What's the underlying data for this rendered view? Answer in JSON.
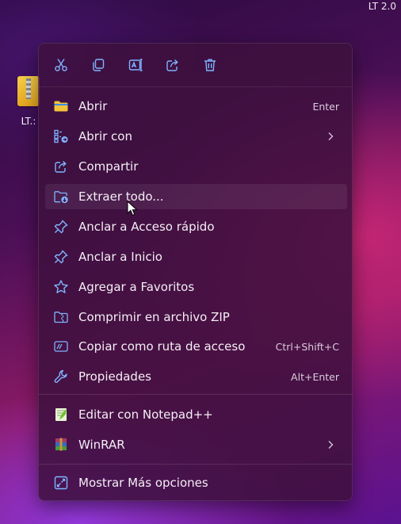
{
  "corner_label": "LT 2.0",
  "desktop": {
    "file_label": "LT.:"
  },
  "toolbar": {
    "buttons": [
      {
        "name": "cut",
        "icon": "scissors-icon"
      },
      {
        "name": "copy",
        "icon": "copy-icon"
      },
      {
        "name": "rename",
        "icon": "rename-icon"
      },
      {
        "name": "share",
        "icon": "share-icon"
      },
      {
        "name": "delete",
        "icon": "trash-icon"
      }
    ]
  },
  "menu": {
    "items": [
      {
        "label": "Abrir",
        "shortcut": "Enter",
        "icon": "folder-icon"
      },
      {
        "label": "Abrir con",
        "submenu": true,
        "icon": "open-with-icon"
      },
      {
        "label": "Compartir",
        "icon": "share-icon"
      },
      {
        "label": "Extraer todo...",
        "icon": "extract-icon",
        "hovered": true
      },
      {
        "label": "Anclar a Acceso rápido",
        "icon": "pin-icon"
      },
      {
        "label": "Anclar a Inicio",
        "icon": "pin-icon"
      },
      {
        "label": "Agregar a Favoritos",
        "icon": "star-icon"
      },
      {
        "label": "Comprimir en archivo ZIP",
        "icon": "zip-folder-icon"
      },
      {
        "label": "Copiar como ruta de acceso",
        "shortcut": "Ctrl+Shift+C",
        "icon": "path-icon"
      },
      {
        "label": "Propiedades",
        "shortcut": "Alt+Enter",
        "icon": "wrench-icon"
      },
      {
        "label": "Editar con Notepad++",
        "icon": "notepadpp-icon"
      },
      {
        "label": "WinRAR",
        "submenu": true,
        "icon": "winrar-icon"
      },
      {
        "label": "Mostrar Más opciones",
        "icon": "more-options-icon"
      }
    ]
  },
  "colors": {
    "icon_blue": "#7fb4ff",
    "folder_yellow": "#f3c23c",
    "menu_bg": "#3e103e"
  }
}
